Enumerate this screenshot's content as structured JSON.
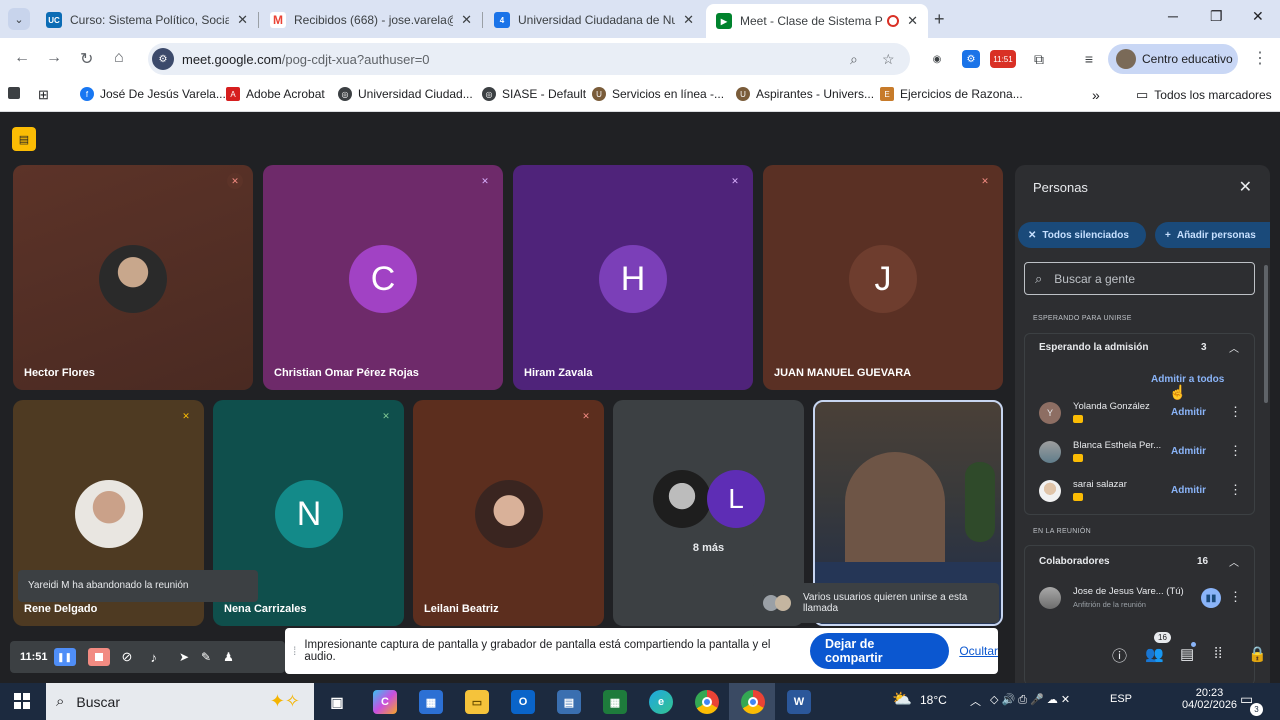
{
  "browser": {
    "tabs": [
      {
        "title": "Curso: Sistema Político, Social d",
        "icon": "uc-icon",
        "color": "#0b6cb5",
        "glyph": "UC"
      },
      {
        "title": "Recibidos (668) - jose.varela@u",
        "icon": "gmail-icon",
        "color": "#ea4335",
        "glyph": "M"
      },
      {
        "title": "Universidad Ciudadana de Nue",
        "icon": "ucn-icon",
        "color": "#1a73e8",
        "glyph": "4"
      },
      {
        "title": "Meet - Clase de Sistema Po",
        "icon": "meet-icon",
        "color": "#00832d",
        "glyph": "▶"
      }
    ],
    "url_host": "meet.google.com",
    "url_path": "/pog-cdjt-xua?authuser=0",
    "ext_time": "11:51",
    "profile_label": "Centro educativo",
    "bookmarks": [
      {
        "label": "José De Jesús Varela...",
        "icon": "facebook-icon",
        "color": "#1877f2",
        "glyph": "f"
      },
      {
        "label": "Adobe Acrobat",
        "icon": "acrobat-icon",
        "color": "#d61f1f",
        "glyph": "A"
      },
      {
        "label": "Universidad Ciudad...",
        "icon": "globe-icon",
        "color": "#3c4043",
        "glyph": "◎"
      },
      {
        "label": "SIASE - Default",
        "icon": "globe-icon",
        "color": "#3c4043",
        "glyph": "◎"
      },
      {
        "label": "Servicios en línea -...",
        "icon": "uanl-icon",
        "color": "#7a5c3a",
        "glyph": "U"
      },
      {
        "label": "Aspirantes - Univers...",
        "icon": "uanl-icon",
        "color": "#7a5c3a",
        "glyph": "U"
      },
      {
        "label": "Ejercicios de Razona...",
        "icon": "bookmark-icon",
        "color": "#c77b2a",
        "glyph": "E"
      }
    ],
    "all_bookmarks": "Todos los marcadores"
  },
  "tiles": [
    {
      "name": "Hector Flores"
    },
    {
      "name": "Christian Omar Pérez Rojas",
      "letter": "C"
    },
    {
      "name": "Hiram Zavala",
      "letter": "H"
    },
    {
      "name": "JUAN MANUEL GUEVARA",
      "letter": "J"
    },
    {
      "name": "Rene Delgado"
    },
    {
      "name": "Nena Carrizales",
      "letter": "N"
    },
    {
      "name": "Leilani Beatriz"
    },
    {
      "more_letter": "L",
      "more_label": "8 más"
    }
  ],
  "toasts": {
    "left_msg": "Yareidi M ha abandonado la reunión",
    "join_msg": "Varios usuarios quieren unirse a esta llamada"
  },
  "people": {
    "title": "Personas",
    "mute_all": "Todos silenciados",
    "add_people": "Añadir personas",
    "search_placeholder": "Buscar a gente",
    "waiting_section": "ESPERANDO PARA UNIRSE",
    "waiting_group": "Esperando la admisión",
    "waiting_count": "3",
    "admit_all": "Admitir a todos",
    "admit": "Admitir",
    "waiting": [
      {
        "name": "Yolanda González",
        "initial": "Y"
      },
      {
        "name": "Blanca Esthela Per...",
        "initial": ""
      },
      {
        "name": "sarai salazar",
        "initial": ""
      }
    ],
    "in_meeting_section": "EN LA REUNIÓN",
    "collab_group": "Colaboradores",
    "collab_count": "16",
    "me_name": "Jose de Jesus Vare... (Tú)",
    "me_role": "Anfitrión de la reunión"
  },
  "recorder": {
    "time": "11:51"
  },
  "share": {
    "message": "Impresionante captura de pantalla y grabador de pantalla está compartiendo la pantalla y el audio.",
    "stop_button": "Dejar de compartir",
    "hide_link": "Ocultar"
  },
  "meet_controls": {
    "people_badge": "16"
  },
  "taskbar": {
    "search_label": "Buscar",
    "temperature": "18°C",
    "language": "ESP",
    "time": "20:23",
    "date": "04/02/2026",
    "notif_count": "3"
  }
}
